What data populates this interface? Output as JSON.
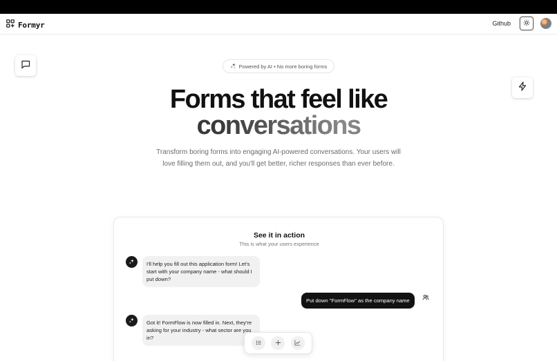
{
  "navbar": {
    "brand": "Formyr",
    "github_label": "Github",
    "icons": {
      "logo": "grid-plus-icon",
      "theme": "sun-icon",
      "avatar": "user-avatar"
    }
  },
  "floating": {
    "left_icon": "message-square-icon",
    "right_icon": "zap-icon"
  },
  "hero": {
    "badge": "Powered by AI • No more boring forms",
    "badge_icon": "sparkles-icon",
    "title_line1": "Forms that feel like",
    "title_line2": "conversations",
    "subtitle": "Transform boring forms into engaging AI-powered conversations. Your users will love filling them out, and you'll get better, richer responses than ever before."
  },
  "demo": {
    "title": "See it in action",
    "subtitle": "This is what your users experience",
    "messages": [
      {
        "role": "bot",
        "text": "I'll help you fill out this application form! Let's start with your company name - what should I put down?"
      },
      {
        "role": "user",
        "text": "Put down \"FormFlow\" as the company name"
      },
      {
        "role": "bot",
        "text": "Got it! FormFlow is now filled in. Next, they're asking for your industry - what sector are you in?"
      }
    ],
    "toolbar_icons": [
      "list-icon",
      "plus-icon",
      "chart-icon"
    ]
  },
  "colors": {
    "accent": "#111111",
    "muted_text": "#6b6b6b",
    "bubble_bot": "#f1f1f1",
    "bubble_user": "#121212"
  }
}
